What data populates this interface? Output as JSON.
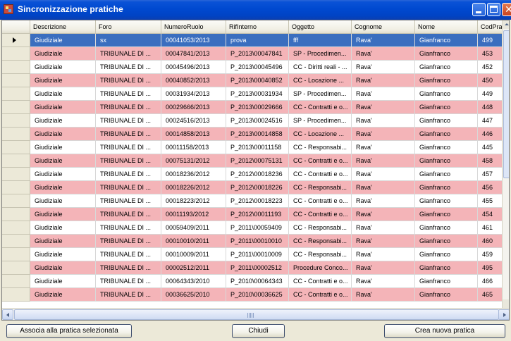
{
  "window": {
    "title": "Sincronizzazione pratiche",
    "icon": "app-icon",
    "controls": [
      "minimize-icon",
      "maximize-icon",
      "close-icon"
    ]
  },
  "grid": {
    "columns": [
      "Descrizione",
      "Foro",
      "NumeroRuolo",
      "RifInterno",
      "Oggetto",
      "Cognome",
      "Nome",
      "CodPrat"
    ],
    "rows": [
      {
        "style": "selected",
        "current": true,
        "cells": [
          "Giudiziale",
          "sx",
          "00041053/2013",
          "prova",
          "fff",
          "Rava'",
          "Gianfranco",
          "499"
        ]
      },
      {
        "style": "pink",
        "cells": [
          "Giudiziale",
          "TRIBUNALE DI ...",
          "00047841/2013",
          "P_2013\\00047841",
          "SP - Procedimen...",
          "Rava'",
          "Gianfranco",
          "453"
        ]
      },
      {
        "style": "white",
        "cells": [
          "Giudiziale",
          "TRIBUNALE DI ...",
          "00045496/2013",
          "P_2013\\00045496",
          "CC - Diritti reali - ...",
          "Rava'",
          "Gianfranco",
          "452"
        ]
      },
      {
        "style": "pink",
        "cells": [
          "Giudiziale",
          "TRIBUNALE DI ...",
          "00040852/2013",
          "P_2013\\00040852",
          "CC - Locazione ...",
          "Rava'",
          "Gianfranco",
          "450"
        ]
      },
      {
        "style": "white",
        "cells": [
          "Giudiziale",
          "TRIBUNALE DI ...",
          "00031934/2013",
          "P_2013\\00031934",
          "SP - Procedimen...",
          "Rava'",
          "Gianfranco",
          "449"
        ]
      },
      {
        "style": "pink",
        "cells": [
          "Giudiziale",
          "TRIBUNALE DI ...",
          "00029666/2013",
          "P_2013\\00029666",
          "CC - Contratti e o...",
          "Rava'",
          "Gianfranco",
          "448"
        ]
      },
      {
        "style": "white",
        "cells": [
          "Giudiziale",
          "TRIBUNALE DI ...",
          "00024516/2013",
          "P_2013\\00024516",
          "SP - Procedimen...",
          "Rava'",
          "Gianfranco",
          "447"
        ]
      },
      {
        "style": "pink",
        "cells": [
          "Giudiziale",
          "TRIBUNALE DI ...",
          "00014858/2013",
          "P_2013\\00014858",
          "CC - Locazione ...",
          "Rava'",
          "Gianfranco",
          "446"
        ]
      },
      {
        "style": "white",
        "cells": [
          "Giudiziale",
          "TRIBUNALE DI ...",
          "00011158/2013",
          "P_2013\\00011158",
          "CC - Responsabi...",
          "Rava'",
          "Gianfranco",
          "445"
        ]
      },
      {
        "style": "pink",
        "cells": [
          "Giudiziale",
          "TRIBUNALE DI ...",
          "00075131/2012",
          "P_2012\\00075131",
          "CC - Contratti e o...",
          "Rava'",
          "Gianfranco",
          "458"
        ]
      },
      {
        "style": "white",
        "cells": [
          "Giudiziale",
          "TRIBUNALE DI ...",
          "00018236/2012",
          "P_2012\\00018236",
          "CC - Contratti e o...",
          "Rava'",
          "Gianfranco",
          "457"
        ]
      },
      {
        "style": "pink",
        "cells": [
          "Giudiziale",
          "TRIBUNALE DI ...",
          "00018226/2012",
          "P_2012\\00018226",
          "CC - Responsabi...",
          "Rava'",
          "Gianfranco",
          "456"
        ]
      },
      {
        "style": "white",
        "cells": [
          "Giudiziale",
          "TRIBUNALE DI ...",
          "00018223/2012",
          "P_2012\\00018223",
          "CC - Contratti e o...",
          "Rava'",
          "Gianfranco",
          "455"
        ]
      },
      {
        "style": "pink",
        "cells": [
          "Giudiziale",
          "TRIBUNALE DI ...",
          "00011193/2012",
          "P_2012\\00011193",
          "CC - Contratti e o...",
          "Rava'",
          "Gianfranco",
          "454"
        ]
      },
      {
        "style": "white",
        "cells": [
          "Giudiziale",
          "TRIBUNALE DI ...",
          "00059409/2011",
          "P_2011\\00059409",
          "CC - Responsabi...",
          "Rava'",
          "Gianfranco",
          "461"
        ]
      },
      {
        "style": "pink",
        "cells": [
          "Giudiziale",
          "TRIBUNALE DI ...",
          "00010010/2011",
          "P_2011\\00010010",
          "CC - Responsabi...",
          "Rava'",
          "Gianfranco",
          "460"
        ]
      },
      {
        "style": "white",
        "cells": [
          "Giudiziale",
          "TRIBUNALE DI ...",
          "00010009/2011",
          "P_2011\\00010009",
          "CC - Responsabi...",
          "Rava'",
          "Gianfranco",
          "459"
        ]
      },
      {
        "style": "pink",
        "cells": [
          "Giudiziale",
          "TRIBUNALE DI ...",
          "00002512/2011",
          "P_2011\\00002512",
          "Procedure Conco...",
          "Rava'",
          "Gianfranco",
          "495"
        ]
      },
      {
        "style": "white",
        "cells": [
          "Giudiziale",
          "TRIBUNALE DI ...",
          "00064343/2010",
          "P_2010\\00064343",
          "CC - Contratti e o...",
          "Rava'",
          "Gianfranco",
          "466"
        ]
      },
      {
        "style": "pink",
        "cells": [
          "Giudiziale",
          "TRIBUNALE DI ...",
          "00036625/2010",
          "P_2010\\00036625",
          "CC - Contratti e o...",
          "Rava'",
          "Gianfranco",
          "465"
        ]
      }
    ]
  },
  "buttons": {
    "associate": "Associa alla pratica selezionata",
    "close": "Chiudi",
    "create": "Crea nuova pratica"
  },
  "colors": {
    "selected_row": "#3a6ebf",
    "pink_row": "#f4b4b8",
    "titlebar": "#0049d0"
  }
}
